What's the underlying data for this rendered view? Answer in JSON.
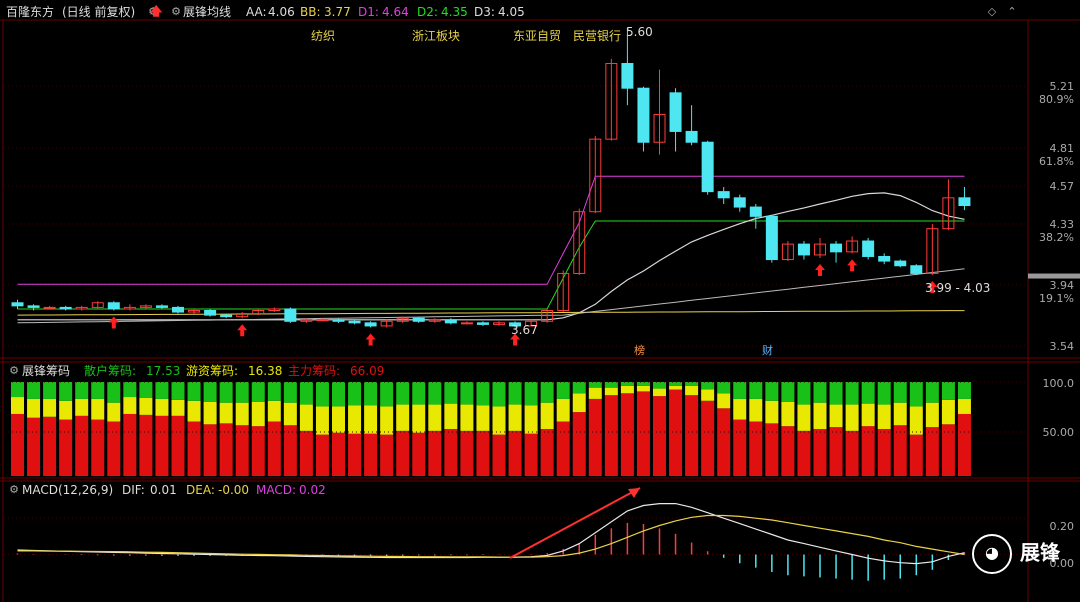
{
  "header": {
    "stock_name": "百隆东方",
    "period_info": "(日线 前复权)",
    "indicator_name": "展锋均线",
    "aa_label": "AA:",
    "aa_value": "4.06",
    "bb_label": "BB:",
    "bb_value": "3.77",
    "d1_label": "D1:",
    "d1_value": "4.64",
    "d2_label": "D2:",
    "d2_value": "4.35",
    "d3_label": "D3:",
    "d3_value": "4.05"
  },
  "sectors": [
    "纺织",
    "浙江板块",
    "东亚自贸",
    "民营银行"
  ],
  "price_axis": {
    "labels": [
      {
        "price": "5.21",
        "pct": "80.9%"
      },
      {
        "price": "4.81",
        "pct": "61.8%"
      },
      {
        "price": "4.57",
        "pct": ""
      },
      {
        "price": "4.33",
        "pct": "38.2%"
      },
      {
        "price": "3.94",
        "pct": "19.1%"
      },
      {
        "price": "3.54",
        "pct": ""
      }
    ]
  },
  "price_notes": {
    "high": "5.60",
    "low": "3.67",
    "range": "3.99 - 4.03"
  },
  "badges": {
    "bang": "榜",
    "cai": "财"
  },
  "chips_header": {
    "title": "展锋筹码",
    "retail_label": "散户筹码:",
    "retail_value": "17.53",
    "hot_label": "游资筹码:",
    "hot_value": "16.38",
    "main_label": "主力筹码:",
    "main_value": "66.09"
  },
  "chips_axis": [
    "100.0",
    "50.00"
  ],
  "macd_header": {
    "title": "MACD(12,26,9)",
    "dif_label": "DIF:",
    "dif_value": "0.01",
    "dea_label": "DEA:",
    "dea_value": "-0.00",
    "macd_label": "MACD:",
    "macd_value": "0.02"
  },
  "macd_axis": [
    "0.20",
    "0.00"
  ],
  "brand": "展锋",
  "colors": {
    "up": "#ff3b3b",
    "down": "#4ee6f0",
    "ma_magenta": "#e040e0",
    "ma_green": "#22dd22",
    "ma_white": "#d8d8d8",
    "ma_yellow": "#e8d24a",
    "retail": "#18c018",
    "hot": "#e8e800",
    "main": "#e01010"
  },
  "chart_data": [
    {
      "type": "candlestick",
      "title": "百隆东方",
      "candles": [
        [
          3.82,
          3.8,
          3.84,
          3.78
        ],
        [
          3.8,
          3.79,
          3.81,
          3.77
        ],
        [
          3.79,
          3.79,
          3.8,
          3.78
        ],
        [
          3.79,
          3.78,
          3.8,
          3.77
        ],
        [
          3.78,
          3.79,
          3.8,
          3.77
        ],
        [
          3.79,
          3.82,
          3.83,
          3.78
        ],
        [
          3.82,
          3.78,
          3.83,
          3.77
        ],
        [
          3.78,
          3.79,
          3.81,
          3.77
        ],
        [
          3.79,
          3.8,
          3.81,
          3.78
        ],
        [
          3.8,
          3.79,
          3.81,
          3.78
        ],
        [
          3.79,
          3.76,
          3.8,
          3.75
        ],
        [
          3.76,
          3.77,
          3.78,
          3.75
        ],
        [
          3.77,
          3.74,
          3.78,
          3.73
        ],
        [
          3.74,
          3.73,
          3.75,
          3.72
        ],
        [
          3.73,
          3.75,
          3.76,
          3.72
        ],
        [
          3.75,
          3.77,
          3.78,
          3.74
        ],
        [
          3.77,
          3.78,
          3.79,
          3.76
        ],
        [
          3.78,
          3.7,
          3.79,
          3.69
        ],
        [
          3.7,
          3.71,
          3.72,
          3.69
        ],
        [
          3.71,
          3.71,
          3.72,
          3.7
        ],
        [
          3.71,
          3.7,
          3.72,
          3.69
        ],
        [
          3.7,
          3.69,
          3.71,
          3.68
        ],
        [
          3.69,
          3.67,
          3.7,
          3.66
        ],
        [
          3.67,
          3.7,
          3.71,
          3.66
        ],
        [
          3.7,
          3.72,
          3.73,
          3.69
        ],
        [
          3.72,
          3.7,
          3.73,
          3.69
        ],
        [
          3.7,
          3.71,
          3.72,
          3.69
        ],
        [
          3.71,
          3.69,
          3.72,
          3.68
        ],
        [
          3.69,
          3.69,
          3.7,
          3.68
        ],
        [
          3.69,
          3.68,
          3.7,
          3.67
        ],
        [
          3.68,
          3.69,
          3.7,
          3.67
        ],
        [
          3.69,
          3.67,
          3.7,
          3.66
        ],
        [
          3.67,
          3.7,
          3.71,
          3.67
        ],
        [
          3.7,
          3.77,
          3.78,
          3.69
        ],
        [
          3.77,
          4.01,
          4.03,
          3.76
        ],
        [
          4.01,
          4.41,
          4.43,
          4.0
        ],
        [
          4.41,
          4.88,
          4.9,
          4.4
        ],
        [
          4.88,
          5.37,
          5.4,
          4.87
        ],
        [
          5.37,
          5.21,
          5.6,
          5.1
        ],
        [
          5.21,
          4.86,
          5.22,
          4.8
        ],
        [
          4.86,
          5.04,
          5.33,
          4.78
        ],
        [
          5.18,
          4.93,
          5.21,
          4.8
        ],
        [
          4.93,
          4.86,
          5.1,
          4.84
        ],
        [
          4.86,
          4.54,
          4.87,
          4.52
        ],
        [
          4.54,
          4.5,
          4.57,
          4.46
        ],
        [
          4.5,
          4.44,
          4.52,
          4.41
        ],
        [
          4.44,
          4.38,
          4.46,
          4.3
        ],
        [
          4.38,
          4.1,
          4.39,
          4.08
        ],
        [
          4.1,
          4.2,
          4.22,
          4.09
        ],
        [
          4.2,
          4.13,
          4.22,
          4.1
        ],
        [
          4.13,
          4.2,
          4.24,
          4.11
        ],
        [
          4.2,
          4.15,
          4.22,
          4.08
        ],
        [
          4.15,
          4.22,
          4.25,
          4.14
        ],
        [
          4.22,
          4.12,
          4.24,
          4.1
        ],
        [
          4.12,
          4.09,
          4.14,
          4.07
        ],
        [
          4.09,
          4.06,
          4.1,
          4.05
        ],
        [
          4.06,
          4.01,
          4.07,
          4.0
        ],
        [
          4.01,
          4.3,
          4.33,
          4.0
        ],
        [
          4.3,
          4.5,
          4.62,
          4.29
        ],
        [
          4.5,
          4.45,
          4.57,
          4.42
        ]
      ]
    },
    {
      "type": "bar",
      "title": "展锋筹码",
      "series": [
        {
          "name": "主力筹码",
          "values": [
            66,
            62,
            63,
            60,
            64,
            60,
            58,
            66,
            65,
            64,
            64,
            58,
            55,
            56,
            54,
            53,
            58,
            54,
            48,
            44,
            46,
            45,
            45,
            44,
            48,
            46,
            48,
            50,
            48,
            48,
            44,
            48,
            45,
            50,
            58,
            68,
            82,
            86,
            88,
            90,
            85,
            92,
            86,
            80,
            72,
            60,
            58,
            56,
            53,
            48,
            50,
            52,
            48,
            53,
            50,
            54,
            44,
            52,
            55,
            66
          ]
        },
        {
          "name": "游资筹码",
          "values": [
            18,
            20,
            19,
            20,
            18,
            22,
            20,
            18,
            18,
            18,
            17,
            22,
            24,
            22,
            24,
            26,
            22,
            24,
            28,
            30,
            28,
            30,
            30,
            30,
            28,
            30,
            28,
            27,
            28,
            27,
            30,
            28,
            30,
            28,
            24,
            20,
            12,
            8,
            8,
            6,
            8,
            4,
            10,
            12,
            16,
            22,
            24,
            24,
            26,
            28,
            28,
            24,
            28,
            24,
            26,
            24,
            30,
            26,
            26,
            16
          ]
        },
        {
          "name": "散户筹码",
          "values": [
            16,
            18,
            18,
            20,
            18,
            18,
            22,
            16,
            17,
            18,
            19,
            20,
            21,
            22,
            22,
            21,
            20,
            22,
            24,
            26,
            26,
            25,
            25,
            26,
            24,
            24,
            24,
            23,
            24,
            25,
            26,
            24,
            25,
            22,
            18,
            12,
            6,
            6,
            4,
            4,
            7,
            4,
            4,
            8,
            12,
            18,
            18,
            20,
            21,
            24,
            22,
            24,
            24,
            23,
            24,
            22,
            26,
            22,
            19,
            18
          ]
        }
      ],
      "ylim": [
        0,
        100
      ]
    },
    {
      "type": "line",
      "title": "MACD(12,26,9)",
      "series": [
        {
          "name": "DIF",
          "values": [
            0.025,
            0.022,
            0.02,
            0.018,
            0.016,
            0.014,
            0.012,
            0.01,
            0.008,
            0.006,
            0.004,
            0.002,
            0.0,
            -0.002,
            -0.004,
            -0.005,
            -0.006,
            -0.008,
            -0.01,
            -0.012,
            -0.013,
            -0.014,
            -0.015,
            -0.016,
            -0.016,
            -0.016,
            -0.016,
            -0.016,
            -0.016,
            -0.015,
            -0.015,
            -0.014,
            -0.012,
            -0.005,
            0.02,
            0.06,
            0.12,
            0.18,
            0.24,
            0.27,
            0.28,
            0.28,
            0.26,
            0.23,
            0.2,
            0.17,
            0.14,
            0.11,
            0.08,
            0.06,
            0.04,
            0.02,
            0.0,
            -0.02,
            -0.035,
            -0.045,
            -0.05,
            -0.04,
            -0.01,
            0.01
          ]
        },
        {
          "name": "DEA",
          "values": [
            0.02,
            0.02,
            0.019,
            0.019,
            0.018,
            0.017,
            0.016,
            0.015,
            0.013,
            0.012,
            0.01,
            0.008,
            0.006,
            0.004,
            0.002,
            0.001,
            -0.001,
            -0.002,
            -0.004,
            -0.005,
            -0.007,
            -0.008,
            -0.009,
            -0.01,
            -0.011,
            -0.012,
            -0.012,
            -0.013,
            -0.013,
            -0.013,
            -0.014,
            -0.014,
            -0.014,
            -0.012,
            -0.006,
            0.008,
            0.03,
            0.06,
            0.095,
            0.13,
            0.16,
            0.185,
            0.205,
            0.215,
            0.215,
            0.21,
            0.2,
            0.19,
            0.175,
            0.16,
            0.145,
            0.13,
            0.115,
            0.1,
            0.08,
            0.065,
            0.045,
            0.03,
            0.015,
            -0.0
          ]
        },
        {
          "name": "MACD",
          "values": [
            0.01,
            0.004,
            0.002,
            -0.002,
            -0.004,
            -0.006,
            -0.008,
            -0.01,
            -0.01,
            -0.012,
            -0.012,
            -0.012,
            -0.012,
            -0.012,
            -0.012,
            -0.012,
            -0.01,
            -0.012,
            -0.012,
            -0.014,
            -0.012,
            -0.012,
            -0.012,
            -0.012,
            -0.01,
            -0.008,
            -0.008,
            -0.006,
            -0.006,
            -0.004,
            -0.002,
            0.0,
            0.004,
            0.014,
            0.052,
            0.104,
            0.18,
            0.24,
            0.29,
            0.28,
            0.24,
            0.19,
            0.11,
            0.03,
            -0.03,
            -0.08,
            -0.12,
            -0.16,
            -0.19,
            -0.2,
            -0.21,
            -0.22,
            -0.23,
            -0.24,
            -0.23,
            -0.22,
            -0.19,
            -0.14,
            -0.05,
            0.02
          ]
        }
      ],
      "ylim": [
        -0.25,
        0.3
      ]
    }
  ]
}
